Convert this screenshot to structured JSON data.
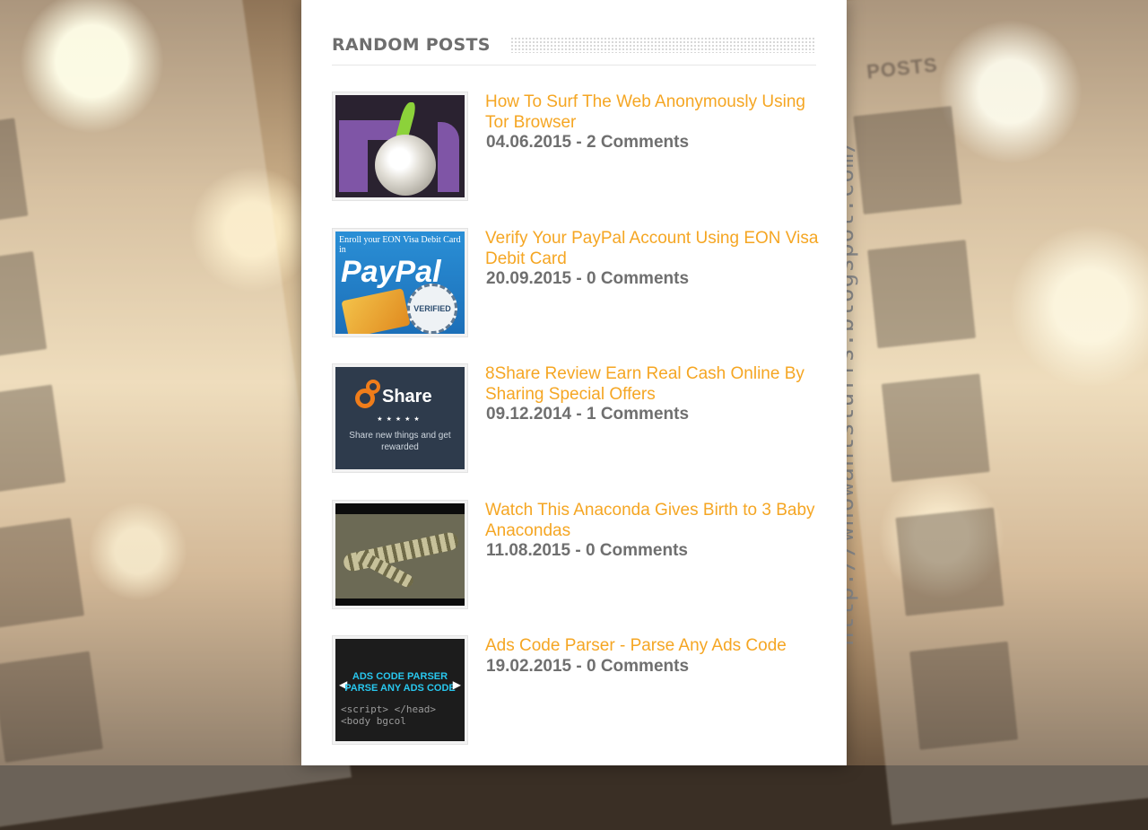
{
  "watermark": "http://whowantstuffs.blogspot.com/",
  "widget": {
    "title": "RANDOM POSTS",
    "posts": [
      {
        "title": "How To Surf The Web Anonymously Using Tor Browser",
        "date": "04.06.2015",
        "comments": "2 Comments",
        "thumb_icon": "tor-onion-icon"
      },
      {
        "title": "Verify Your PayPal Account Using EON Visa Debit Card",
        "date": "20.09.2015",
        "comments": "0 Comments",
        "thumb_icon": "paypal-verified-icon"
      },
      {
        "title": "8Share Review Earn Real Cash Online By Sharing Special Offers",
        "date": "09.12.2014",
        "comments": "1 Comments",
        "thumb_icon": "8share-logo-icon"
      },
      {
        "title": "Watch This Anaconda Gives Birth to 3 Baby Anacondas",
        "date": "11.08.2015",
        "comments": "0 Comments",
        "thumb_icon": "anaconda-image"
      },
      {
        "title": "Ads Code Parser - Parse Any Ads Code",
        "date": "19.02.2015",
        "comments": "0 Comments",
        "thumb_icon": "ads-code-icon"
      }
    ]
  },
  "thumbs": {
    "paypal_line": "Enroll your EON Visa Debit Card in",
    "paypal_brand": "PayPal",
    "paypal_seal": "VERIFIED",
    "share_name": "Share",
    "share_stars": "★★★★★",
    "share_tag": "Share new things and get rewarded",
    "ads_banner": "ADS CODE PARSER PARSE ANY ADS CODE",
    "ads_code": "<script> </head> <body bgcol"
  },
  "ghost": {
    "head": "POSTS"
  },
  "colors": {
    "title": "#f5a623",
    "meta": "#6f6f6f",
    "heading": "#6e6e6e",
    "panel": "#ffffff"
  }
}
